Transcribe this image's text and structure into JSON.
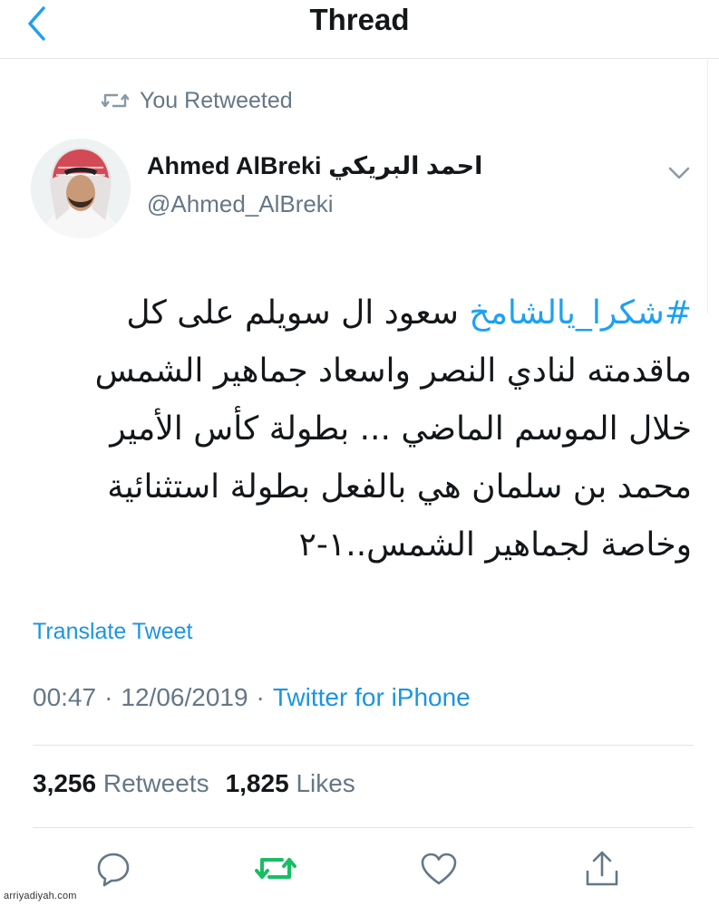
{
  "header": {
    "title": "Thread"
  },
  "retweet_context": {
    "text": "You Retweeted"
  },
  "author": {
    "display_name": "Ahmed AlBreki احمد البريكي",
    "handle": "@Ahmed_AlBreki"
  },
  "tweet": {
    "hashtag": "#شكرا_يالشامخ",
    "lines": [
      "سعود ال سويلم على كل",
      "ماقدمته لنادي النصر واسعاد جماهير الشمس",
      "خلال الموسم الماضي ... بطولة كأس الأمير",
      "محمد بن سلمان هي بالفعل بطولة استثنائية",
      "وخاصة لجماهير الشمس..١-٢"
    ],
    "translate_label": "Translate Tweet"
  },
  "meta": {
    "time": "00:47",
    "date": "12/06/2019",
    "separator": "·",
    "source": "Twitter for iPhone"
  },
  "stats": {
    "retweets_count": "3,256",
    "retweets_label": "Retweets",
    "likes_count": "1,825",
    "likes_label": "Likes"
  },
  "actions": [
    "reply-icon",
    "retweet-icon",
    "like-icon",
    "share-icon"
  ],
  "colors": {
    "accent": "#1da1f2",
    "link": "#1b95e0",
    "retweet_active": "#17bf63",
    "secondary_text": "#657786",
    "icon_gray": "#657786"
  },
  "watermark": "arriyadiyah.com"
}
